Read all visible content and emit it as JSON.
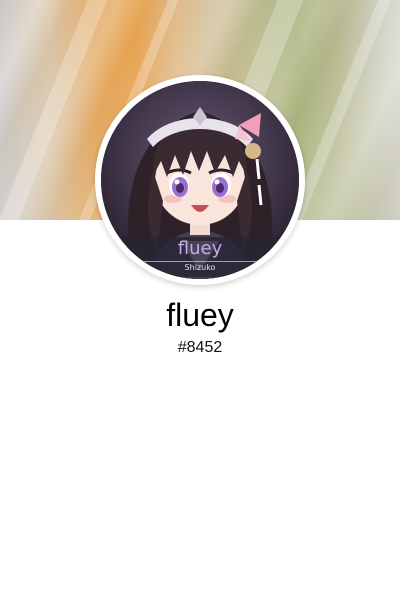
{
  "profile": {
    "username": "fluey",
    "discriminator": "#8452",
    "avatar_plate_name": "fluey",
    "avatar_plate_subtitle": "Shizuko"
  },
  "colors": {
    "banner_left": "#c9c6c4",
    "banner_orange": "#e6a24e",
    "banner_olive": "#a9b27c",
    "banner_right": "#d2d1c8",
    "background": "#ffffff",
    "plate_name": "#c9a8f0"
  },
  "icons": {
    "avatar": "anime-girl-avatar"
  }
}
